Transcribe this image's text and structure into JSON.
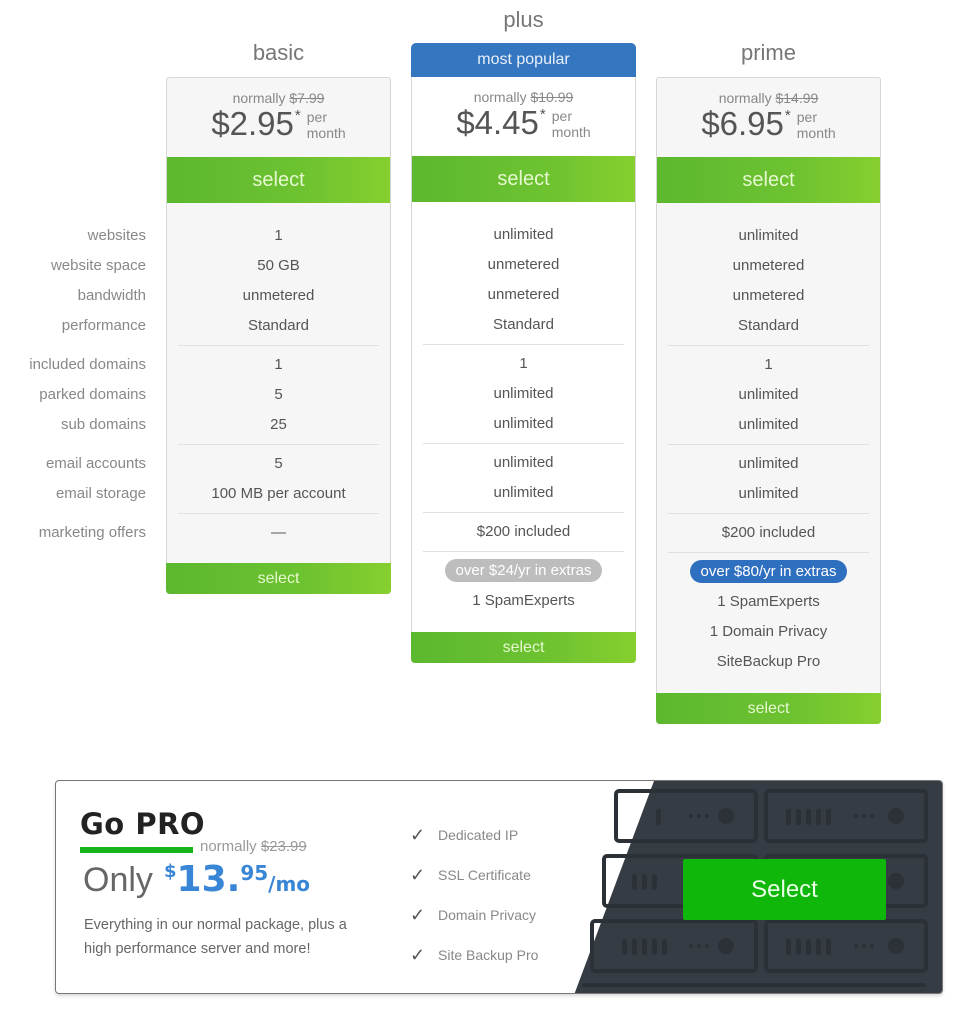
{
  "feature_labels": [
    [
      "websites",
      "website space",
      "bandwidth",
      "performance"
    ],
    [
      "included domains",
      "parked domains",
      "sub domains"
    ],
    [
      "email accounts",
      "email storage"
    ],
    [
      "marketing offers"
    ]
  ],
  "plans": [
    {
      "name": "basic",
      "normally_label": "normally",
      "normally_price": "$7.99",
      "price": "$2.95",
      "asterisk": "*",
      "per": "per",
      "period": "month",
      "select_label": "select",
      "groups": [
        [
          "1",
          "50 GB",
          "unmetered",
          "Standard"
        ],
        [
          "1",
          "5",
          "25"
        ],
        [
          "5",
          "100 MB per account"
        ],
        [
          "—"
        ]
      ],
      "extras_badge": null,
      "extras": [],
      "bottom_select_label": "select"
    },
    {
      "name": "plus",
      "badge": "most popular",
      "normally_label": "normally",
      "normally_price": "$10.99",
      "price": "$4.45",
      "asterisk": "*",
      "per": "per",
      "period": "month",
      "select_label": "select",
      "groups": [
        [
          "unlimited",
          "unmetered",
          "unmetered",
          "Standard"
        ],
        [
          "1",
          "unlimited",
          "unlimited"
        ],
        [
          "unlimited",
          "unlimited"
        ],
        [
          "$200 included"
        ]
      ],
      "extras_badge": "over $24/yr in extras",
      "extras": [
        "1 SpamExperts"
      ],
      "bottom_select_label": "select"
    },
    {
      "name": "prime",
      "normally_label": "normally",
      "normally_price": "$14.99",
      "price": "$6.95",
      "asterisk": "*",
      "per": "per",
      "period": "month",
      "select_label": "select",
      "groups": [
        [
          "unlimited",
          "unmetered",
          "unmetered",
          "Standard"
        ],
        [
          "1",
          "unlimited",
          "unlimited"
        ],
        [
          "unlimited",
          "unlimited"
        ],
        [
          "$200 included"
        ]
      ],
      "extras_badge": "over $80/yr in extras",
      "extras": [
        "1 SpamExperts",
        "1 Domain Privacy",
        "SiteBackup Pro"
      ],
      "bottom_select_label": "select"
    }
  ],
  "colors": {
    "green_button": "#6dc230",
    "blue_badge": "#3576c0",
    "gray_pill": "#bdbdbd",
    "pro_green": "#0fb70b",
    "pro_price_blue": "#3a86d6",
    "pro_dark": "#363c44"
  },
  "pro": {
    "title": "Go PRO",
    "normally_label": "normally",
    "normally_price": "$23.99",
    "only_label": "Only",
    "currency": "$",
    "price_int": "13.",
    "price_dec": "95",
    "per": "/mo",
    "description": "Everything in our normal package, plus a high performance server and more!",
    "features": [
      "Dedicated IP",
      "SSL Certificate",
      "Domain Privacy",
      "Site Backup Pro"
    ],
    "check_icon": "✓",
    "select_label": "Select"
  }
}
